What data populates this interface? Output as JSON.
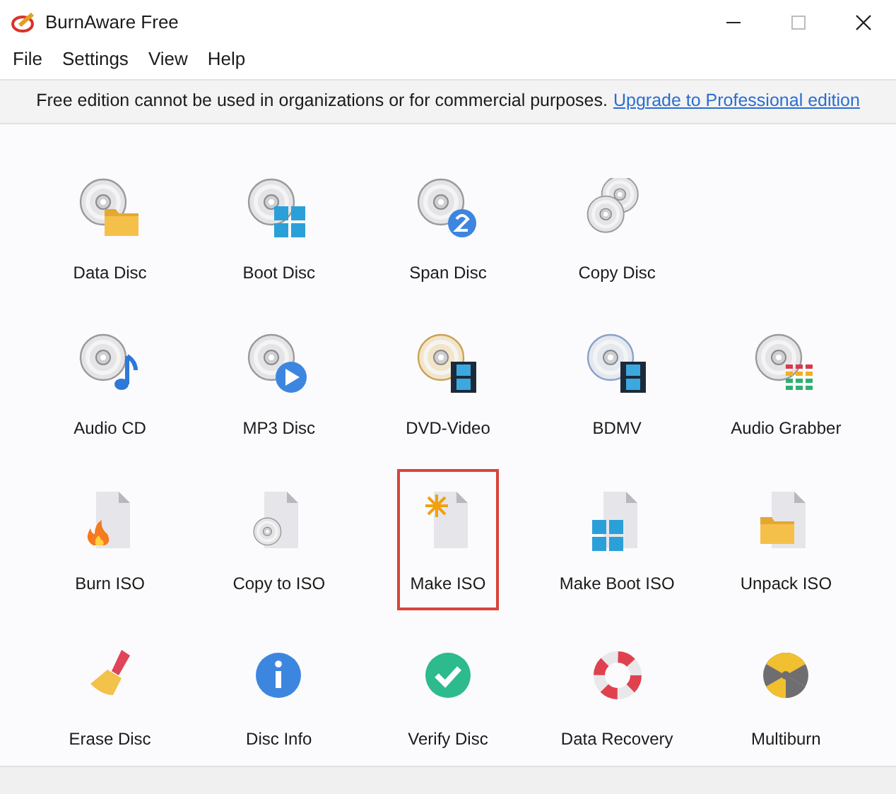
{
  "window": {
    "title": "BurnAware Free"
  },
  "menu": [
    "File",
    "Settings",
    "View",
    "Help"
  ],
  "notice": {
    "text": "Free edition cannot be used in organizations or for commercial purposes.",
    "link": "Upgrade to Professional edition"
  },
  "tools": [
    {
      "label": "Data Disc",
      "selected": false
    },
    {
      "label": "Boot Disc",
      "selected": false
    },
    {
      "label": "Span Disc",
      "selected": false
    },
    {
      "label": "Copy Disc",
      "selected": false
    },
    {
      "label": "Audio CD",
      "selected": false
    },
    {
      "label": "MP3 Disc",
      "selected": false
    },
    {
      "label": "DVD-Video",
      "selected": false
    },
    {
      "label": "BDMV",
      "selected": false
    },
    {
      "label": "Audio Grabber",
      "selected": false
    },
    {
      "label": "Burn ISO",
      "selected": false
    },
    {
      "label": "Copy to ISO",
      "selected": false
    },
    {
      "label": "Make ISO",
      "selected": true
    },
    {
      "label": "Make Boot ISO",
      "selected": false
    },
    {
      "label": "Unpack ISO",
      "selected": false
    },
    {
      "label": "Erase Disc",
      "selected": false
    },
    {
      "label": "Disc Info",
      "selected": false
    },
    {
      "label": "Verify Disc",
      "selected": false
    },
    {
      "label": "Data Recovery",
      "selected": false
    },
    {
      "label": "Multiburn",
      "selected": false
    }
  ]
}
